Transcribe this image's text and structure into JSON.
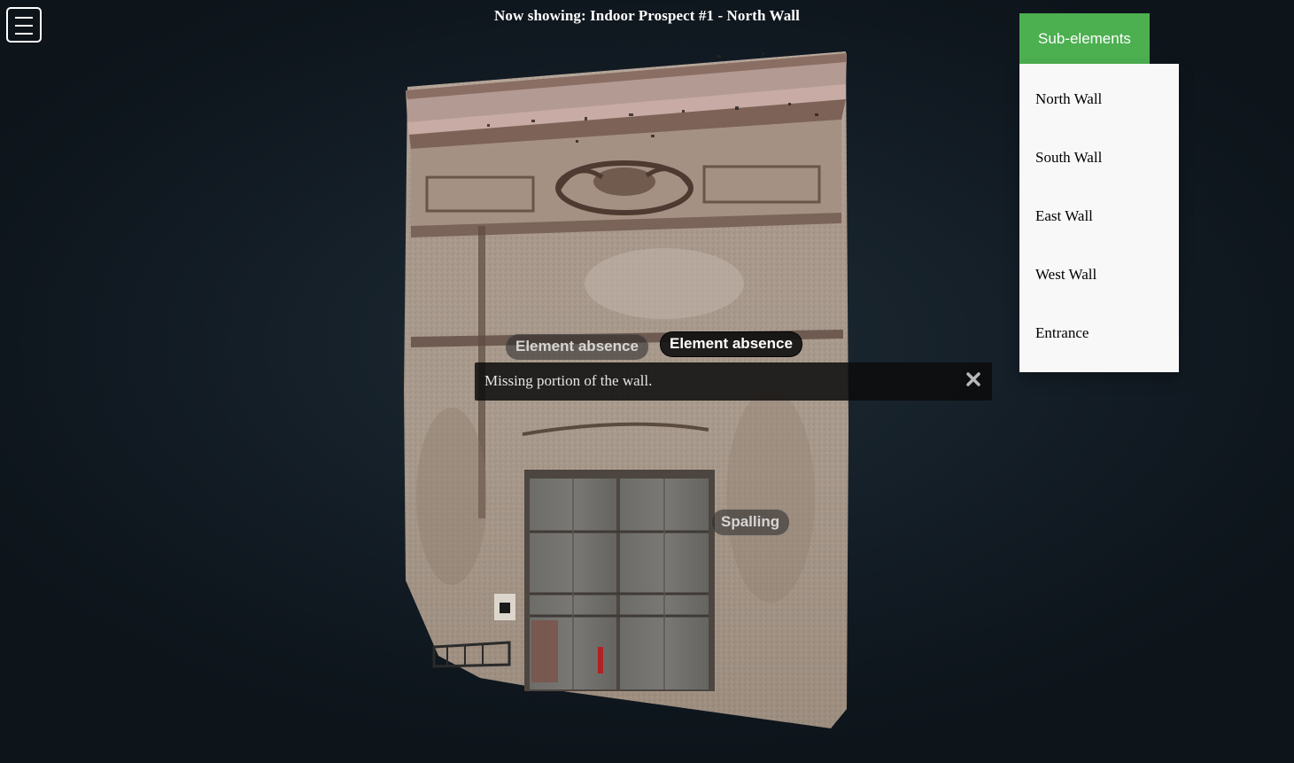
{
  "header": {
    "title": "Now showing: Indoor Prospect #1 - North Wall",
    "menu_icon": "hamburger-menu-icon"
  },
  "viewer": {
    "model_name": "North Wall point cloud",
    "annotations": [
      {
        "label": "Element absence",
        "state": "inactive"
      },
      {
        "label": "Element absence",
        "state": "active"
      },
      {
        "label": "Spalling",
        "state": "inactive"
      }
    ],
    "popup": {
      "description": "Missing portion of the wall.",
      "close_icon": "close-icon"
    }
  },
  "subelements": {
    "button_label": "Sub-elements",
    "items": [
      "North Wall",
      "South Wall",
      "East Wall",
      "West Wall",
      "Entrance"
    ]
  },
  "colors": {
    "accent": "#4caf50",
    "menu_bg": "#f8f8f8",
    "background": "#16212a"
  }
}
